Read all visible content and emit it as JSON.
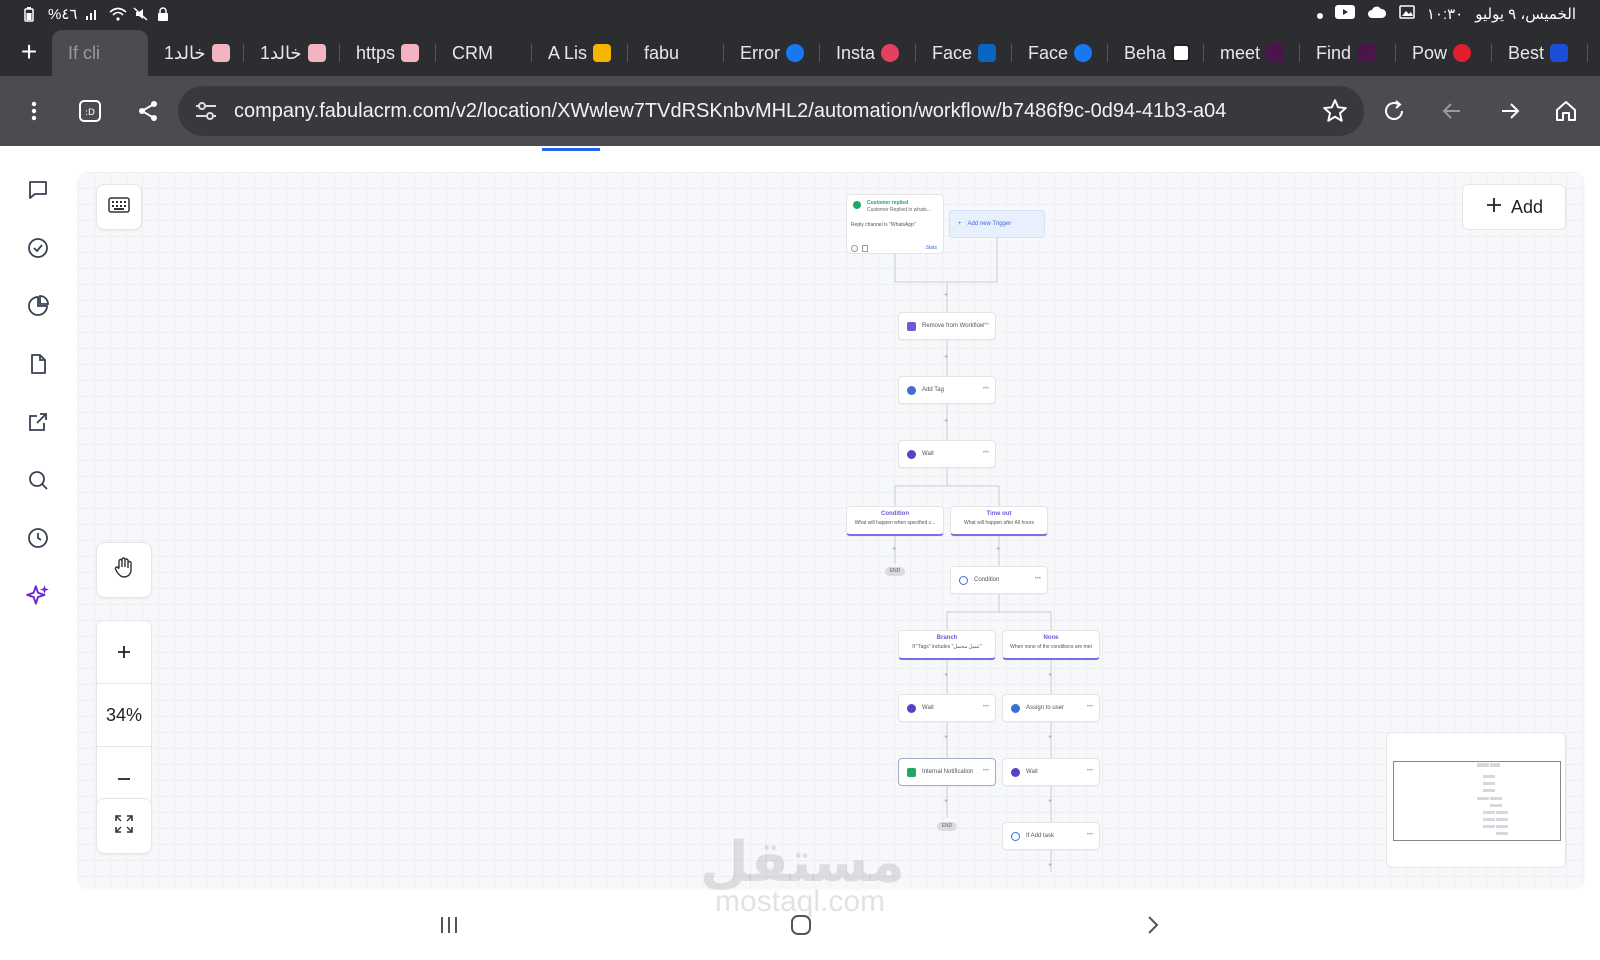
{
  "status_bar": {
    "left_text": "%٤٦",
    "time": "١٠:٣٠",
    "date": "الخميس، ٩ يوليو"
  },
  "tabs": [
    {
      "label": "If cli",
      "active": true,
      "favicon": "none"
    },
    {
      "label": "1خالد",
      "favicon": "pink-image"
    },
    {
      "label": "1خالد",
      "favicon": "pink-image"
    },
    {
      "label": "https",
      "favicon": "pink-image"
    },
    {
      "label": "CRM",
      "favicon": "none"
    },
    {
      "label": "A Lis",
      "favicon": "analytics-icon"
    },
    {
      "label": "fabu",
      "favicon": "none"
    },
    {
      "label": "Error",
      "favicon": "facebook-icon"
    },
    {
      "label": "Insta",
      "favicon": "instagram-icon"
    },
    {
      "label": "Face",
      "favicon": "meta-icon"
    },
    {
      "label": "Face",
      "favicon": "facebook-icon"
    },
    {
      "label": "Beha",
      "favicon": "miro-icon"
    },
    {
      "label": "meet",
      "favicon": "slack-icon"
    },
    {
      "label": "Find",
      "favicon": "slack-icon"
    },
    {
      "label": "Pow",
      "favicon": "red-icon"
    },
    {
      "label": "Best",
      "favicon": "blue-icon"
    }
  ],
  "url": "company.fabulacrm.com/v2/location/XWwlew7TVdRSKnbvMHL2/automation/workflow/b7486f9c-0d94-41b3-a04",
  "canvas": {
    "zoom_level": "34%",
    "add_button_label": "Add"
  },
  "workflow": {
    "trigger": {
      "title": "Customer replied",
      "subtitle": "Customer Replied in whats...",
      "filter": "Reply channel is \"WhatsApp\"",
      "stats_label": "Stats"
    },
    "add_trigger_label": "Add new Trigger",
    "actions": {
      "remove_from_workflow": "Remove from Workflow",
      "add_tag": "Add Tag",
      "wait_1": "Wait",
      "condition": "Condition",
      "wait_2": "Wait",
      "assign_to_user": "Assign to user",
      "internal_notification": "Internal Notification",
      "wait_3": "Wait",
      "if_add_task": "If Add task"
    },
    "branches": {
      "condition_title": "Condition",
      "condition_desc": "What will happen when specified c...",
      "timeout_title": "Time out",
      "timeout_desc": "What will happen after All hours",
      "branch_title": "Branch",
      "branch_desc": "If \"Tags\" includes \"عميل محتمل\"",
      "none_title": "None",
      "none_desc": "When none of the conditions are met"
    },
    "end_label": "END"
  },
  "watermark": {
    "arabic": "مستقل",
    "latin": "mostaql.com"
  },
  "colors": {
    "accent": "#2563eb",
    "branch_purple": "#7c6ee6",
    "ai_purple": "#6d5bd0"
  }
}
